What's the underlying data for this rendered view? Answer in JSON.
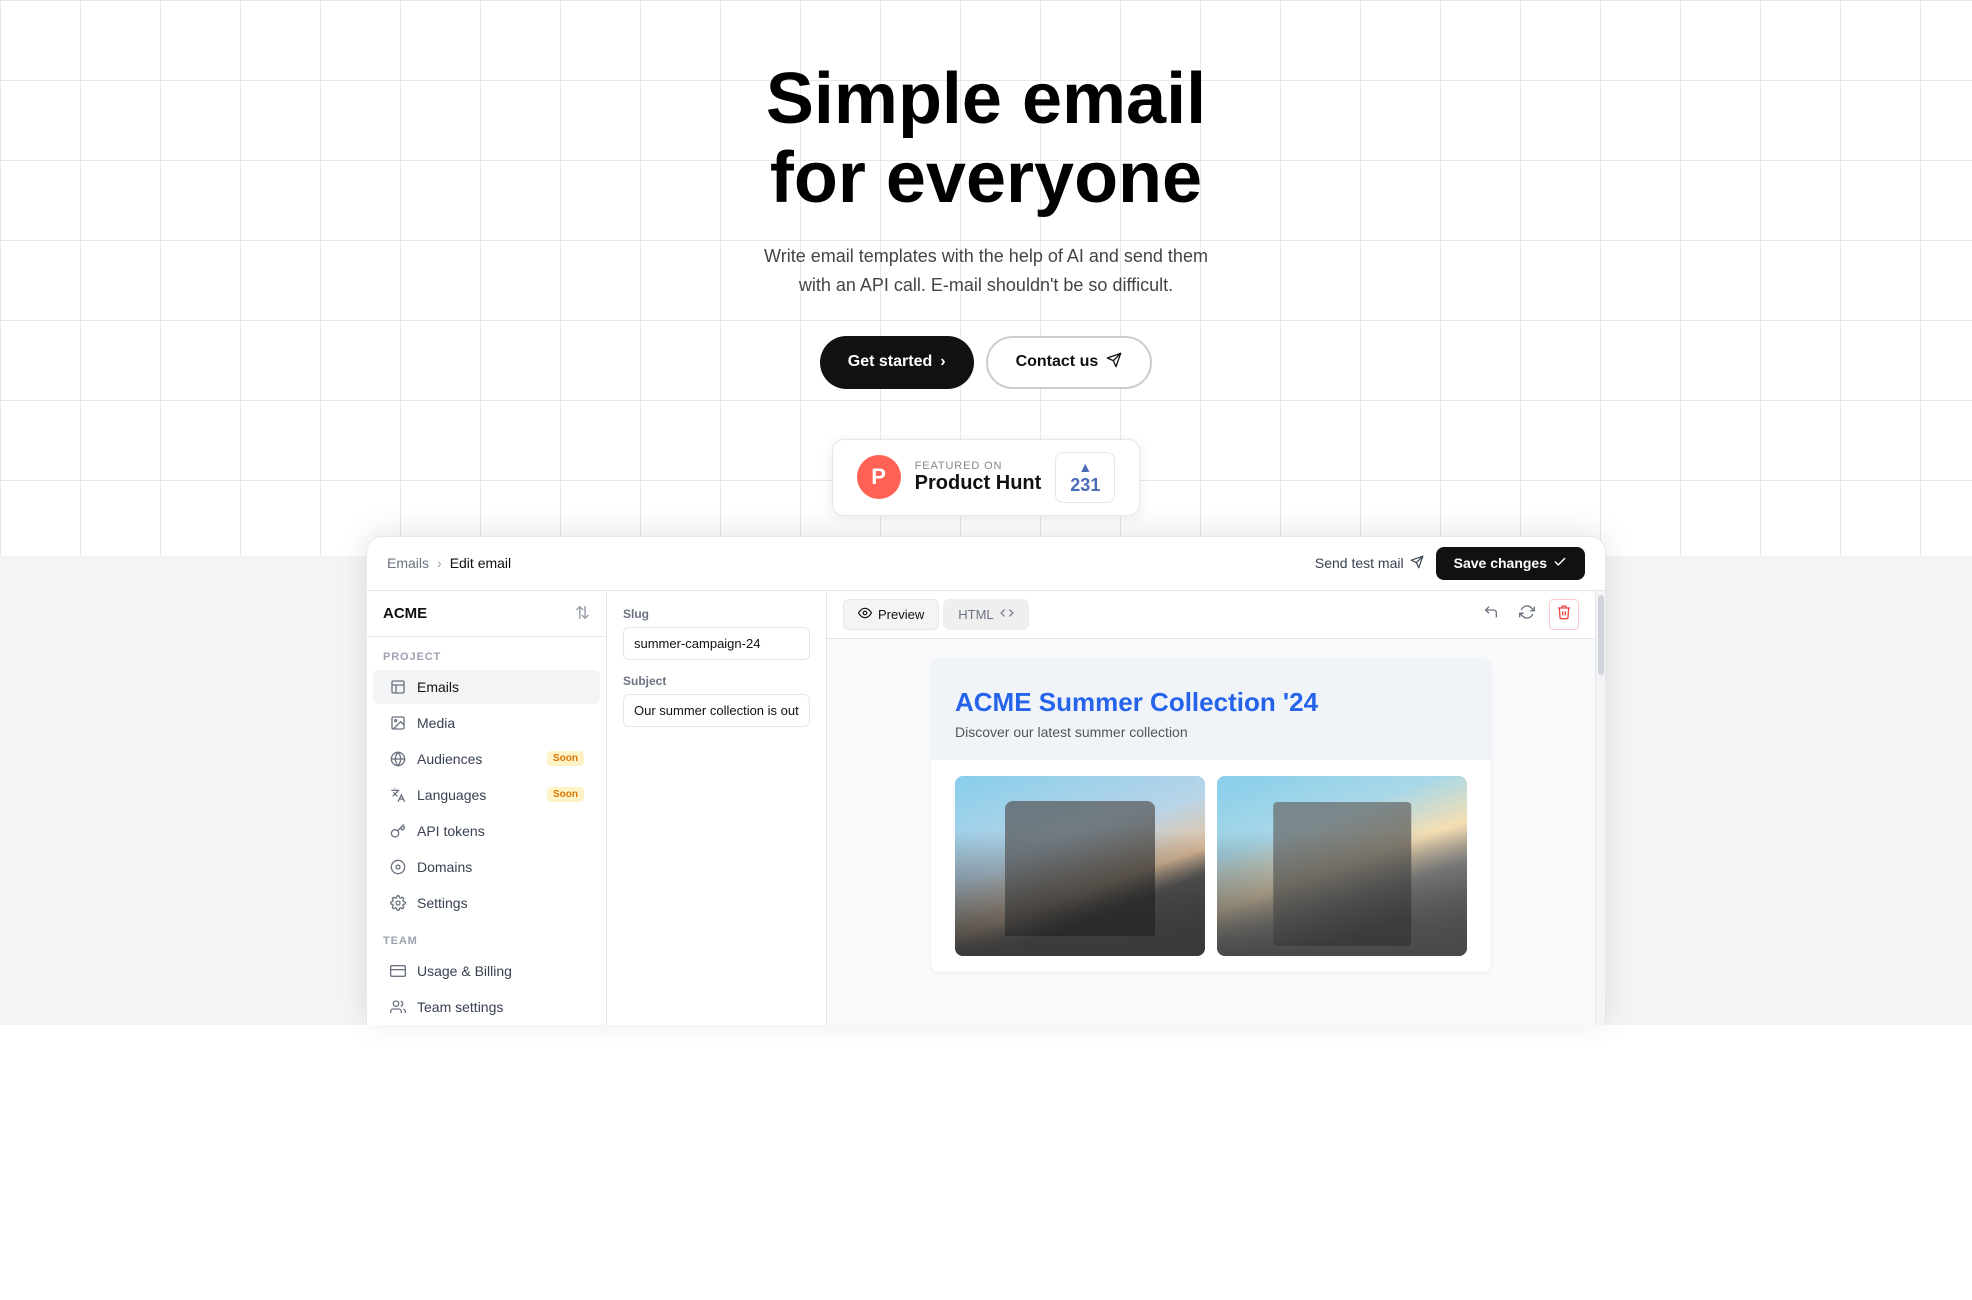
{
  "hero": {
    "title_line1": "Simple email",
    "title_line2": "for everyone",
    "subtitle": "Write email templates with the help of AI and send them with an API call. E-mail shouldn't be so difficult.",
    "cta_primary": "Get started",
    "cta_primary_icon": "›",
    "cta_secondary": "Contact us",
    "cta_secondary_icon": "✈"
  },
  "product_hunt": {
    "featured_label": "FEATURED ON",
    "name": "Product Hunt",
    "votes": "231",
    "logo_letter": "P"
  },
  "app": {
    "topbar": {
      "breadcrumb_parent": "Emails",
      "breadcrumb_separator": ">",
      "breadcrumb_current": "Edit email",
      "send_test_label": "Send test mail",
      "save_changes_label": "Save changes",
      "save_icon": "✓"
    },
    "sidebar": {
      "org_name": "ACME",
      "project_label": "PROJECT",
      "team_label": "TEAM",
      "nav_items": [
        {
          "id": "emails",
          "label": "Emails",
          "icon": "⊞",
          "active": true,
          "badge": null
        },
        {
          "id": "media",
          "label": "Media",
          "icon": "⊟",
          "active": false,
          "badge": null
        },
        {
          "id": "audiences",
          "label": "Audiences",
          "icon": "🌐",
          "active": false,
          "badge": "Soon"
        },
        {
          "id": "languages",
          "label": "Languages",
          "icon": "⚡",
          "active": false,
          "badge": "Soon"
        },
        {
          "id": "api-tokens",
          "label": "API tokens",
          "icon": "⚙",
          "active": false,
          "badge": null
        },
        {
          "id": "domains",
          "label": "Domains",
          "icon": "◎",
          "active": false,
          "badge": null
        },
        {
          "id": "settings",
          "label": "Settings",
          "icon": "⚙",
          "active": false,
          "badge": null
        }
      ],
      "team_items": [
        {
          "id": "usage-billing",
          "label": "Usage & Billing",
          "icon": "💳",
          "badge": null
        },
        {
          "id": "team-settings",
          "label": "Team settings",
          "icon": "👥",
          "badge": null
        }
      ]
    },
    "edit_panel": {
      "slug_label": "Slug",
      "slug_value": "summer-campaign-24",
      "subject_label": "Subject",
      "subject_value": "Our summer collection is out now!"
    },
    "preview": {
      "tab_preview": "Preview",
      "tab_html": "HTML",
      "html_icon": "<>",
      "preview_icon": "👁",
      "email": {
        "header_title": "ACME Summer Collection '24",
        "header_sub": "Discover our latest summer collection"
      }
    }
  }
}
